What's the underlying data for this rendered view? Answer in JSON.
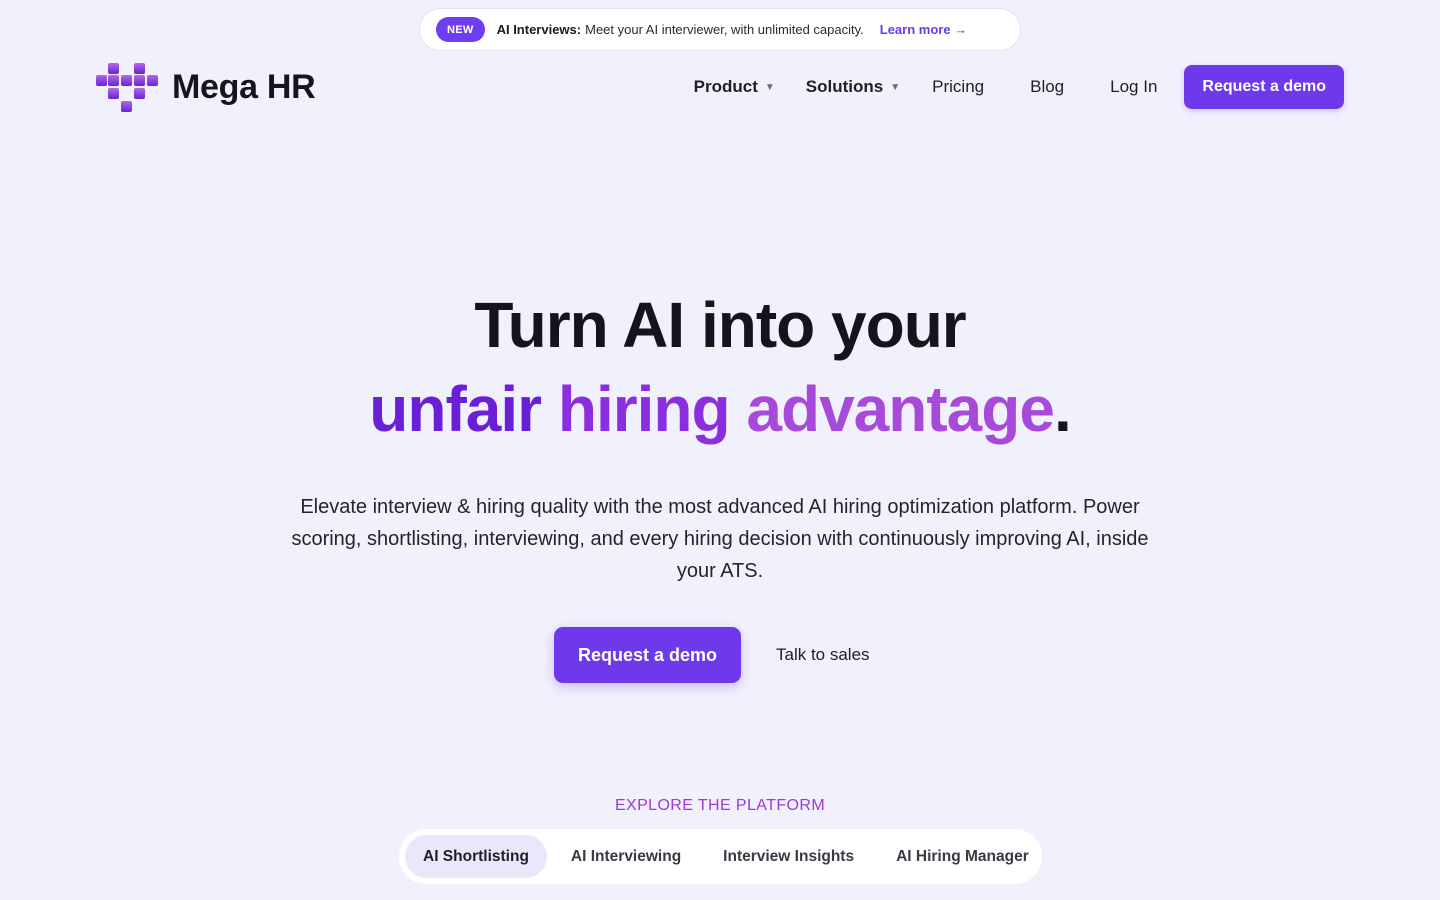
{
  "announcement": {
    "badge": "NEW",
    "title": "AI Interviews:",
    "text": "Meet your AI interviewer, with unlimited capacity.",
    "link": "Learn more →"
  },
  "brand": {
    "name": "Mega HR",
    "logo_icon": "pixel-heart-icon",
    "accent": "#6d39ea"
  },
  "nav": {
    "product": "Product",
    "solutions": "Solutions",
    "pricing": "Pricing",
    "blog": "Blog",
    "login": "Log In",
    "demo": "Request a demo",
    "caret": "▼"
  },
  "hero": {
    "line1": "Turn AI into your",
    "line2_word1": "unfair",
    "line2_word2": "hiring",
    "line2_word3": "advantage",
    "line2_dot": ".",
    "subtitle": "Elevate interview & hiring quality with the most advanced AI hiring optimization platform. Power scoring, shortlisting, interviewing, and every hiring decision with continuously improving AI, inside your ATS.",
    "cta_primary": "Request a demo",
    "cta_secondary": "Talk to sales"
  },
  "explore": {
    "label": "EXPLORE THE PLATFORM",
    "tabs": [
      {
        "label": "AI Shortlisting",
        "active": true
      },
      {
        "label": "AI Interviewing",
        "active": false
      },
      {
        "label": "Interview Insights",
        "active": false
      },
      {
        "label": "AI Hiring Manager",
        "active": false
      }
    ]
  }
}
